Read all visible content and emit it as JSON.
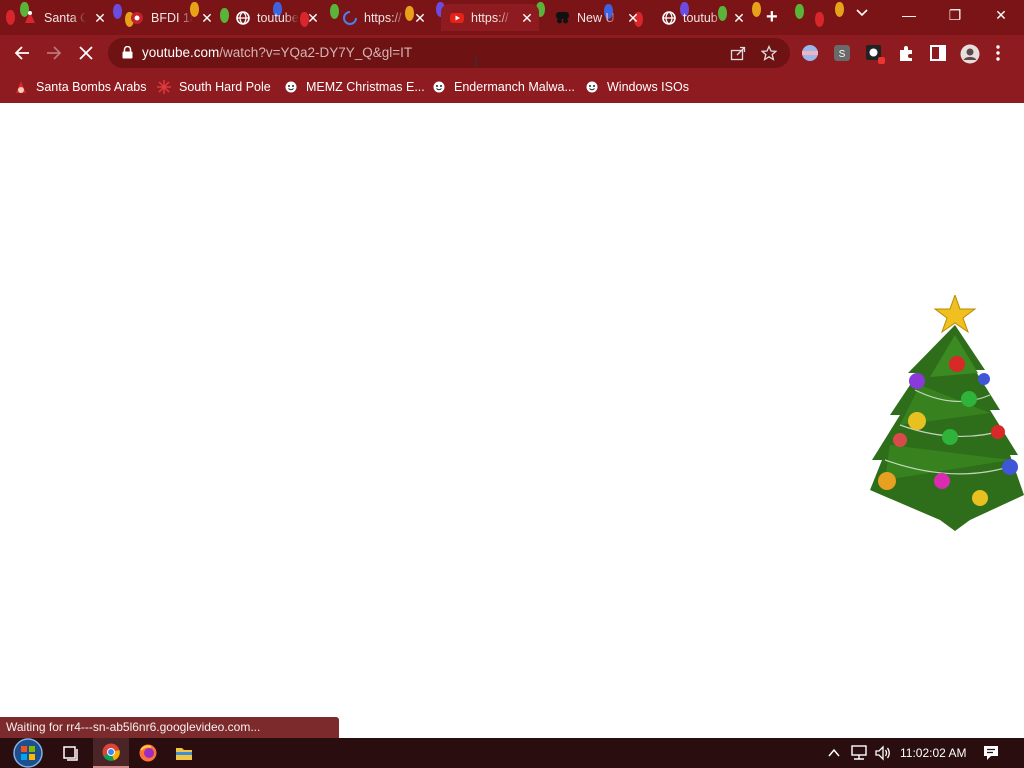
{
  "browser": {
    "tabs": [
      {
        "title": "Santa C",
        "favicon": "santa-icon"
      },
      {
        "title": "BFDI 1a",
        "favicon": "bfdi-icon"
      },
      {
        "title": "toutube",
        "favicon": "globe-icon"
      },
      {
        "title": "https://",
        "favicon": "loading-spinner-icon"
      },
      {
        "title": "https://",
        "favicon": "youtube-icon"
      },
      {
        "title": "New U",
        "favicon": "incognito-icon"
      },
      {
        "title": "toutub",
        "favicon": "globe-icon"
      }
    ],
    "close_glyph": "✕",
    "new_tab_glyph": "+",
    "window": {
      "minimize": "—",
      "restore": "❐",
      "close": "✕"
    }
  },
  "toolbar": {
    "url_domain": "youtube.com",
    "url_path": "/watch?v=YQa2-DY7Y_Q&gl=IT"
  },
  "bookmarks": [
    {
      "label": "Santa Bombs Arabs",
      "icon": "santa-icon"
    },
    {
      "label": "South Hard Pole",
      "icon": "snowflake-icon"
    },
    {
      "label": "MEMZ Christmas E...",
      "icon": "smiley-icon"
    },
    {
      "label": "Endermanch Malwa...",
      "icon": "smiley-icon"
    },
    {
      "label": "Windows ISOs",
      "icon": "smiley-icon"
    }
  ],
  "status": {
    "text": "Waiting for rr4---sn-ab5l6nr6.googlevideo.com..."
  },
  "taskbar": {
    "clock": "11:02:02 AM",
    "items": [
      "start-icon",
      "task-view-icon",
      "chrome-icon",
      "firefox-icon",
      "file-explorer-icon"
    ]
  },
  "colors": {
    "chrome_frame": "#7a1416",
    "toolbar": "#8d1b1f",
    "taskbar": "#2a0d0f"
  }
}
